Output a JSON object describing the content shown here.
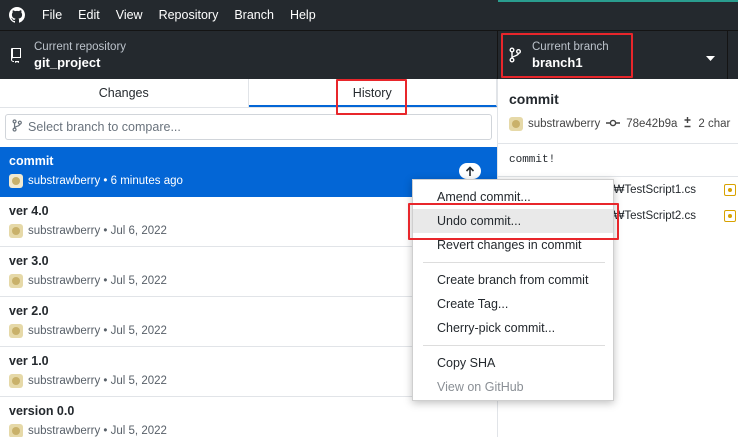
{
  "menubar": {
    "items": [
      "File",
      "Edit",
      "View",
      "Repository",
      "Branch",
      "Help"
    ]
  },
  "toolbar": {
    "repo_label": "Current repository",
    "repo_value": "git_project",
    "branch_label": "Current branch",
    "branch_value": "branch1"
  },
  "tabs": {
    "changes": "Changes",
    "history": "History"
  },
  "compare": {
    "placeholder": "Select branch to compare..."
  },
  "commits": [
    {
      "title": "commit",
      "author": "substrawberry",
      "time": "6 minutes ago"
    },
    {
      "title": "ver 4.0",
      "author": "substrawberry",
      "time": "Jul 6, 2022"
    },
    {
      "title": "ver 3.0",
      "author": "substrawberry",
      "time": "Jul 5, 2022"
    },
    {
      "title": "ver 2.0",
      "author": "substrawberry",
      "time": "Jul 5, 2022"
    },
    {
      "title": "ver 1.0",
      "author": "substrawberry",
      "time": "Jul 5, 2022"
    },
    {
      "title": "version 0.0",
      "author": "substrawberry",
      "time": "Jul 5, 2022"
    }
  ],
  "detail": {
    "title": "commit",
    "author": "substrawberry",
    "sha": "78e42b9a",
    "changes": "2 char",
    "message": "commit!",
    "files": [
      "ts...₩TestScript1.cs",
      "ts...₩TestScript2.cs"
    ]
  },
  "context_menu": {
    "amend": "Amend commit...",
    "undo": "Undo commit...",
    "revert": "Revert changes in commit",
    "create_branch": "Create branch from commit",
    "create_tag": "Create Tag...",
    "cherry_pick": "Cherry-pick commit...",
    "copy_sha": "Copy SHA",
    "view_github": "View on GitHub"
  },
  "colors": {
    "accent": "#0366d6",
    "dark": "#24292e",
    "annotation": "#e8262b"
  }
}
